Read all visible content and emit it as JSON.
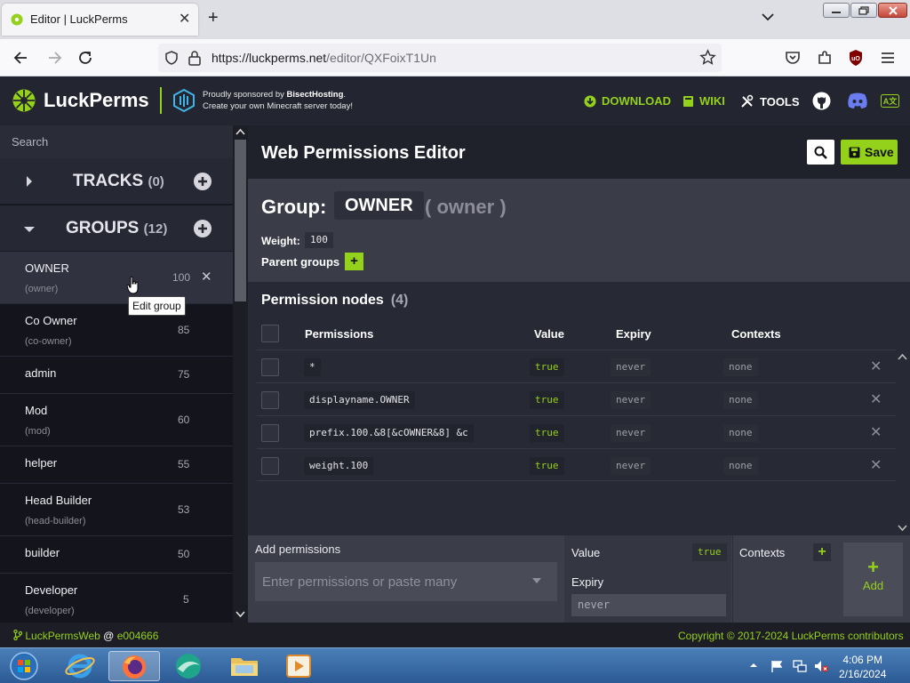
{
  "browser": {
    "tab_title": "Editor | LuckPerms",
    "url_host": "https://luckperms.net",
    "url_path": "/editor/QXFoixT1Un"
  },
  "header": {
    "brand": "LuckPerms",
    "sponsor_prefix": "Proudly sponsored by ",
    "sponsor_name": "BisectHosting",
    "sponsor_suffix": ".",
    "sponsor_line2": "Create your own Minecraft server today!",
    "download": "DOWNLOAD",
    "wiki": "WIKI",
    "tools": "TOOLS"
  },
  "sidebar": {
    "search_placeholder": "Search",
    "tracks_label": "TRACKS",
    "tracks_count": "(0)",
    "groups_label": "GROUPS",
    "groups_count": "(12)",
    "groups": [
      {
        "name": "OWNER",
        "id": "(owner)",
        "weight": "100"
      },
      {
        "name": "Co Owner",
        "id": "(co-owner)",
        "weight": "85"
      },
      {
        "name": "admin",
        "id": "",
        "weight": "75"
      },
      {
        "name": "Mod",
        "id": "(mod)",
        "weight": "60"
      },
      {
        "name": "helper",
        "id": "",
        "weight": "55"
      },
      {
        "name": "Head Builder",
        "id": "(head-builder)",
        "weight": "53"
      },
      {
        "name": "builder",
        "id": "",
        "weight": "50"
      },
      {
        "name": "Developer",
        "id": "(developer)",
        "weight": "5"
      }
    ],
    "tooltip": "Edit group"
  },
  "main": {
    "title": "Web Permissions Editor",
    "save_label": "Save",
    "group_label": "Group:",
    "group_name": "OWNER",
    "group_id": "( owner )",
    "weight_label": "Weight:",
    "weight_value": "100",
    "parent_label": "Parent groups",
    "nodes_title": "Permission nodes",
    "nodes_count": "(4)",
    "columns": [
      "Permissions",
      "Value",
      "Expiry",
      "Contexts"
    ],
    "rows": [
      {
        "perm": "*",
        "value": "true",
        "expiry": "never",
        "contexts": "none"
      },
      {
        "perm": "displayname.OWNER",
        "value": "true",
        "expiry": "never",
        "contexts": "none"
      },
      {
        "perm": "prefix.100.&8[&cOWNER&8] &c",
        "value": "true",
        "expiry": "never",
        "contexts": "none"
      },
      {
        "perm": "weight.100",
        "value": "true",
        "expiry": "never",
        "contexts": "none"
      }
    ],
    "add": {
      "label": "Add permissions",
      "placeholder": "Enter permissions or paste many",
      "value_label": "Value",
      "value": "true",
      "expiry_label": "Expiry",
      "expiry": "never",
      "contexts_label": "Contexts",
      "add_label": "Add"
    }
  },
  "footer": {
    "left_link": "LuckPermsWeb",
    "left_at": " @ ",
    "left_commit": "e004666",
    "right": "Copyright © 2017-2024 LuckPerms contributors"
  },
  "taskbar": {
    "time": "4:06 PM",
    "date": "2/16/2024"
  },
  "colors": {
    "accent": "#94d11a",
    "header_bg": "#232530",
    "sidebar_bg": "#14151c"
  }
}
